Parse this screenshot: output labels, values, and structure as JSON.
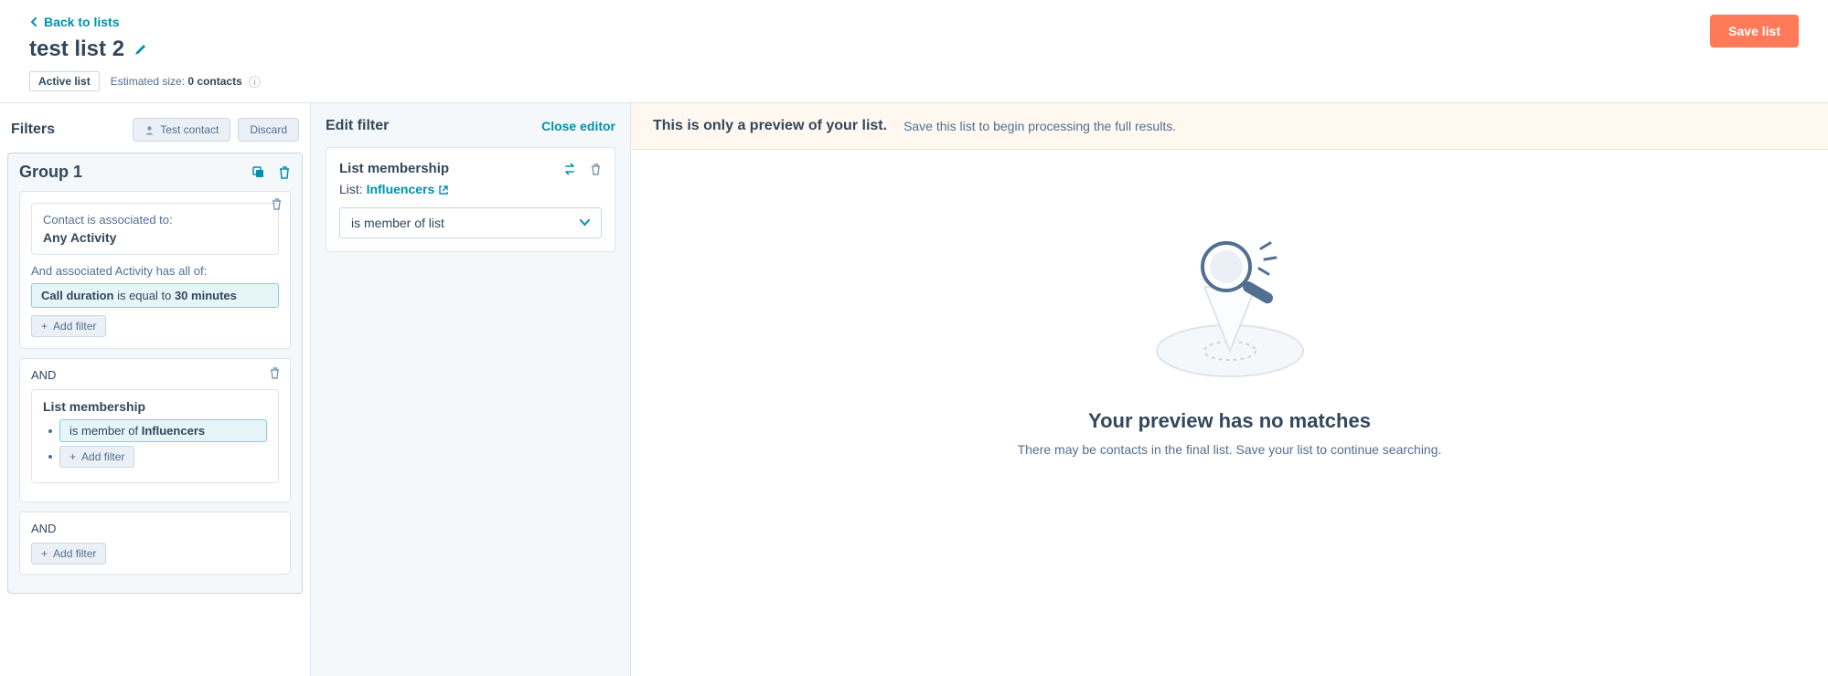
{
  "back_link": "Back to lists",
  "title": "test list 2",
  "badge": "Active list",
  "est_prefix": "Estimated size: ",
  "est_value": "0 contacts",
  "save": "Save list",
  "filters": {
    "title": "Filters",
    "test_contact": "Test contact",
    "discard": "Discard",
    "group_title": "Group 1",
    "block1": {
      "assoc_label": "Contact is associated to:",
      "assoc_value": "Any Activity",
      "and_text": "And associated Activity has all of:",
      "rule_field": "Call duration",
      "rule_mid": " is equal to ",
      "rule_value": "30 minutes",
      "add_filter": "Add filter"
    },
    "and1": "AND",
    "block2": {
      "title": "List membership",
      "rule_prefix": "is member of ",
      "rule_value": "Influencers",
      "add_filter": "Add filter"
    },
    "and2": "AND",
    "block3_add": "Add filter"
  },
  "editor": {
    "title": "Edit filter",
    "close": "Close editor",
    "card_title": "List membership",
    "list_label": "List: ",
    "list_name": "Influencers",
    "select_value": "is member of list"
  },
  "preview": {
    "banner_title": "This is only a preview of your list.",
    "banner_sub": "Save this list to begin processing the full results.",
    "empty_title": "Your preview has no matches",
    "empty_sub": "There may be contacts in the final list. Save your list to continue searching."
  }
}
